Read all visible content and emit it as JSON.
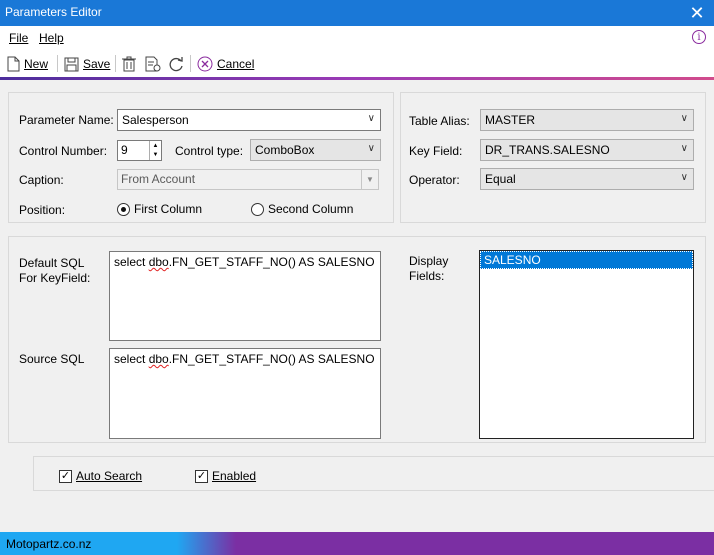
{
  "window": {
    "title": "Parameters Editor",
    "close_glyph": "✕"
  },
  "menu": {
    "file": "File",
    "help": "Help",
    "info_glyph": "i"
  },
  "toolbar": {
    "new_label": "New",
    "save_label": "Save",
    "cancel_label": "Cancel"
  },
  "left_panel": {
    "parameter_name_label": "Parameter Name:",
    "parameter_name_value": "Salesperson",
    "control_number_label": "Control Number:",
    "control_number_value": "9",
    "control_type_label": "Control type:",
    "control_type_value": "ComboBox",
    "caption_label": "Caption:",
    "caption_value": "From Account",
    "position_label": "Position:",
    "first_column": "First Column",
    "second_column": "Second Column"
  },
  "right_panel": {
    "table_alias_label": "Table Alias:",
    "table_alias_value": "MASTER",
    "key_field_label": "Key Field:",
    "key_field_value": "DR_TRANS.SALESNO",
    "operator_label": "Operator:",
    "operator_value": "Equal"
  },
  "sql_panel": {
    "default_sql_label_1": "Default SQL",
    "default_sql_label_2": "For KeyField:",
    "default_sql_prefix": "select ",
    "default_sql_dbo": "dbo",
    "default_sql_rest": ".FN_GET_STAFF_NO() AS SALESNO",
    "source_sql_label": "Source SQL",
    "source_sql_prefix": "select ",
    "source_sql_dbo": "dbo",
    "source_sql_rest": ".FN_GET_STAFF_NO() AS SALESNO",
    "display_fields_label_1": "Display",
    "display_fields_label_2": "Fields:",
    "display_fields_items": [
      "SALESNO"
    ]
  },
  "options": {
    "auto_search": "Auto Search",
    "enabled": "Enabled"
  },
  "status": {
    "site": "Motopartz.co.nz"
  }
}
